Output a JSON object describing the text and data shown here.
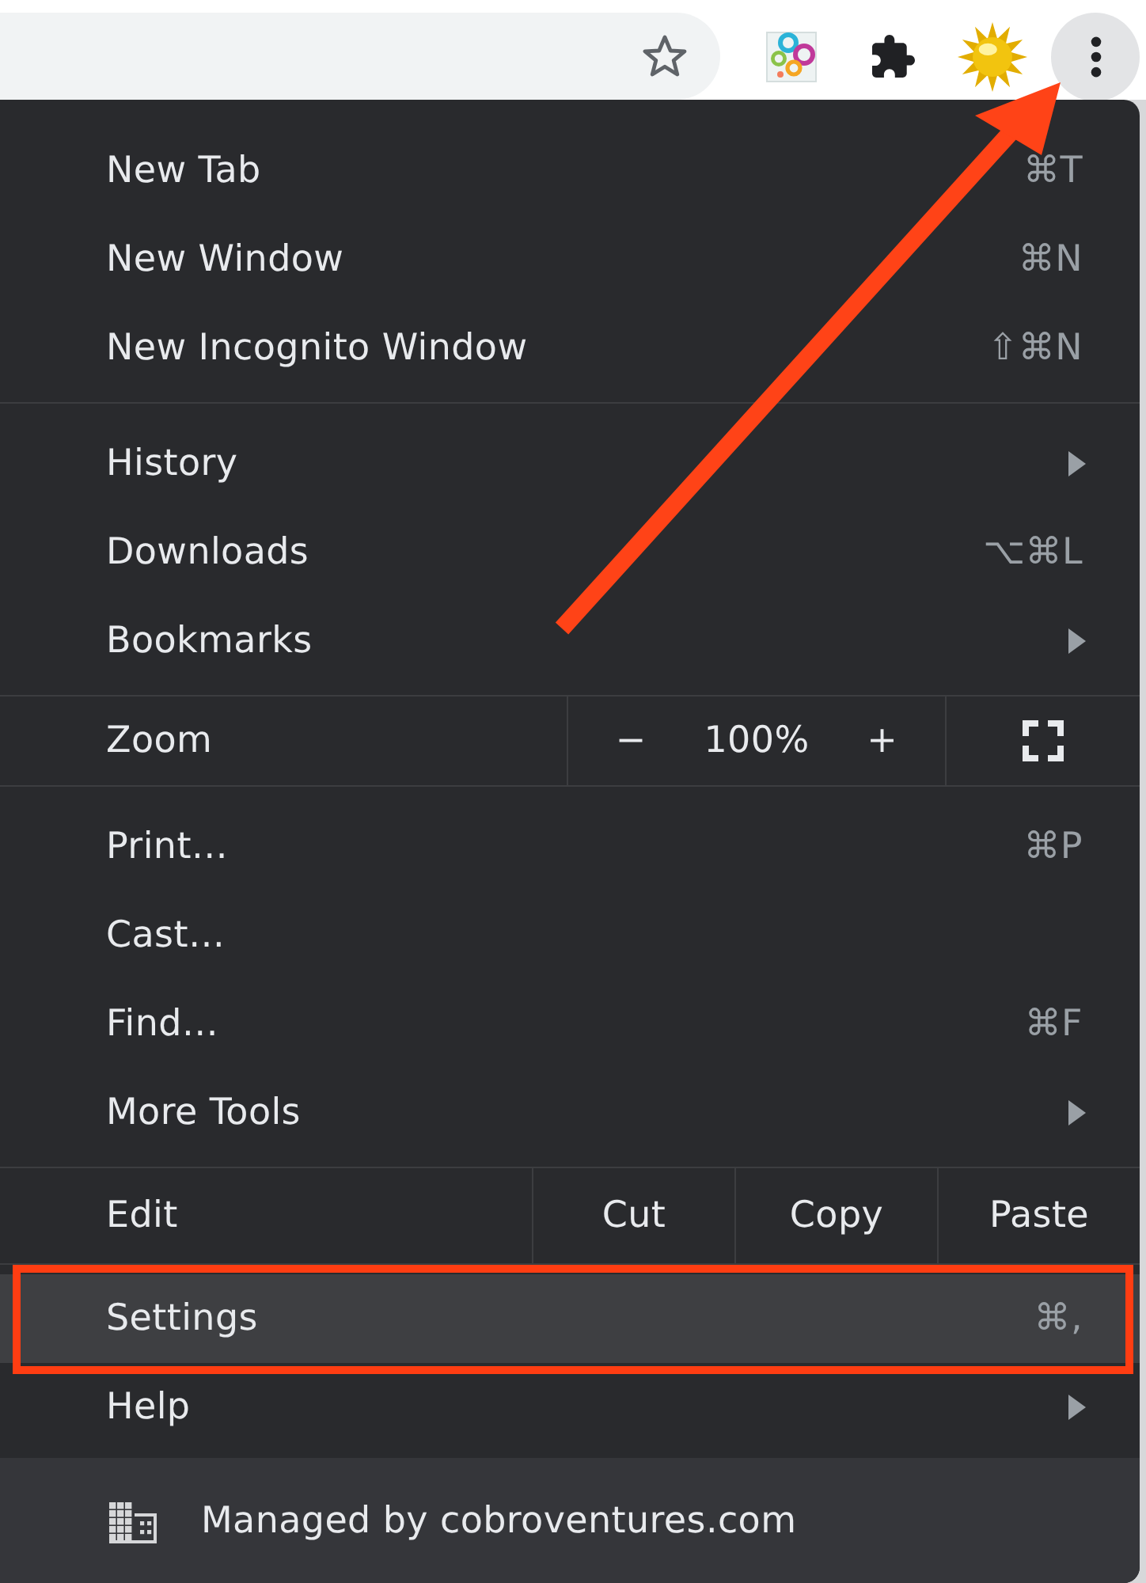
{
  "toolbar": {
    "menu_pressed": true
  },
  "menu": {
    "sections": [
      {
        "kind": "items",
        "items": [
          {
            "label": "New Tab",
            "shortcut": "⌘T",
            "submenu": false,
            "selected": false
          },
          {
            "label": "New Window",
            "shortcut": "⌘N",
            "submenu": false,
            "selected": false
          },
          {
            "label": "New Incognito Window",
            "shortcut": "⇧⌘N",
            "submenu": false,
            "selected": false
          }
        ]
      },
      {
        "kind": "items",
        "items": [
          {
            "label": "History",
            "submenu": true,
            "selected": false
          },
          {
            "label": "Downloads",
            "shortcut": "⌥⌘L",
            "submenu": false,
            "selected": false
          },
          {
            "label": "Bookmarks",
            "submenu": true,
            "selected": false
          }
        ]
      },
      {
        "kind": "zoom",
        "label": "Zoom",
        "minus": "−",
        "value": "100%",
        "plus": "+"
      },
      {
        "kind": "items",
        "items": [
          {
            "label": "Print…",
            "shortcut": "⌘P",
            "submenu": false,
            "selected": false
          },
          {
            "label": "Cast…",
            "submenu": false,
            "selected": false
          },
          {
            "label": "Find…",
            "shortcut": "⌘F",
            "submenu": false,
            "selected": false
          },
          {
            "label": "More Tools",
            "submenu": true,
            "selected": false
          }
        ]
      },
      {
        "kind": "edit",
        "label": "Edit",
        "actions": [
          "Cut",
          "Copy",
          "Paste"
        ]
      },
      {
        "kind": "items",
        "items": [
          {
            "label": "Settings",
            "shortcut": "⌘,",
            "submenu": false,
            "selected": true
          },
          {
            "label": "Help",
            "submenu": true,
            "selected": false
          }
        ]
      }
    ],
    "footer": "Managed by cobroventures.com"
  },
  "annotations": {
    "arrow": true,
    "frame": true
  }
}
